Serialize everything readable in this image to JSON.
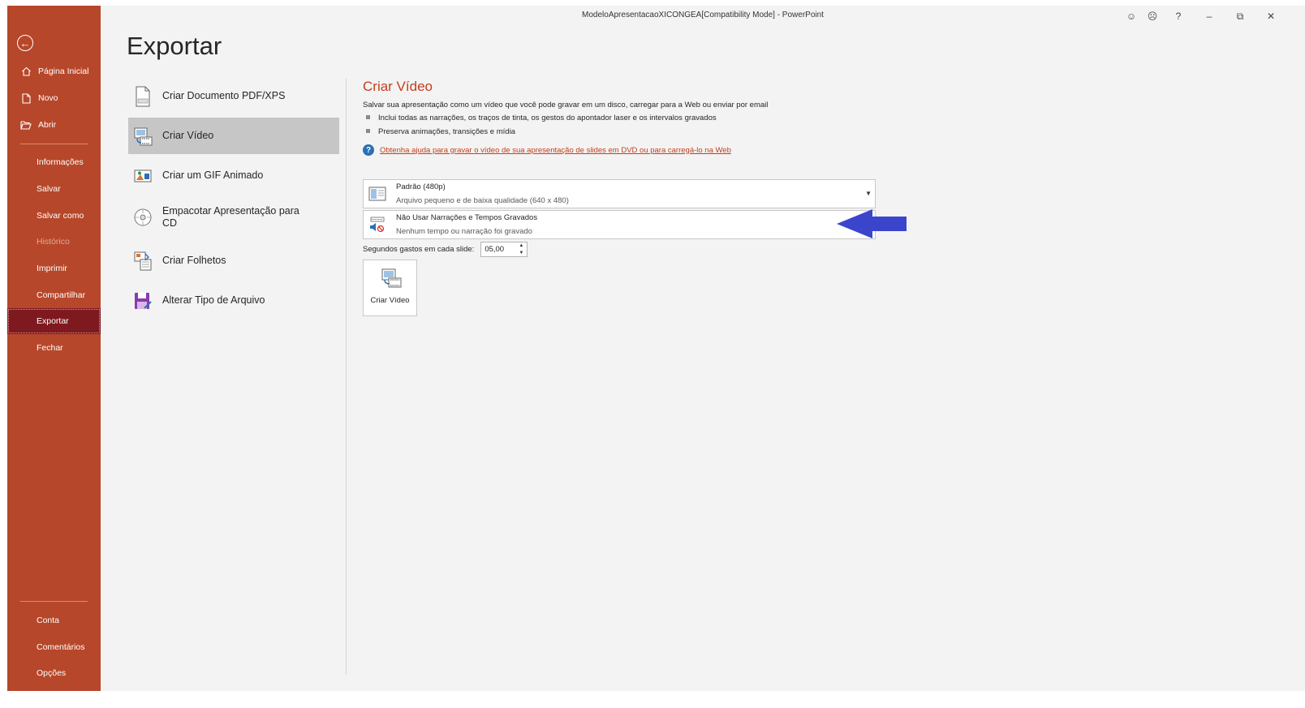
{
  "window": {
    "title": "ModeloApresentacaoXICONGEA[Compatibility Mode]  -  PowerPoint",
    "buttons": {
      "smile": "☺",
      "frown": "☹",
      "help": "?",
      "minimize": "–",
      "restore": "⧉",
      "close": "✕"
    }
  },
  "sidebar": {
    "back_glyph": "←",
    "top_items": [
      {
        "label": "Página Inicial",
        "icon": "home-icon"
      },
      {
        "label": "Novo",
        "icon": "new-document-icon"
      },
      {
        "label": "Abrir",
        "icon": "folder-open-icon"
      }
    ],
    "items": [
      {
        "label": "Informações"
      },
      {
        "label": "Salvar"
      },
      {
        "label": "Salvar como"
      },
      {
        "label": "Histórico",
        "disabled": true
      },
      {
        "label": "Imprimir"
      },
      {
        "label": "Compartilhar"
      },
      {
        "label": "Exportar",
        "active": true
      },
      {
        "label": "Fechar"
      }
    ],
    "bottom_items": [
      {
        "label": "Conta"
      },
      {
        "label": "Comentários"
      },
      {
        "label": "Opções"
      }
    ]
  },
  "page": {
    "title": "Exportar"
  },
  "export_options": [
    {
      "label": "Criar Documento PDF/XPS",
      "icon": "pdf-document-icon"
    },
    {
      "label": "Criar Vídeo",
      "icon": "create-video-icon",
      "selected": true
    },
    {
      "label": "Criar um GIF Animado",
      "icon": "animated-gif-icon"
    },
    {
      "label": "Empacotar Apresentação para CD",
      "icon": "cd-package-icon"
    },
    {
      "label": "Criar Folhetos",
      "icon": "handouts-icon"
    },
    {
      "label": "Alterar Tipo de Arquivo",
      "icon": "change-file-type-icon"
    }
  ],
  "video_pane": {
    "title": "Criar Vídeo",
    "description": "Salvar sua apresentação como um vídeo que você pode gravar em um disco, carregar para a Web ou enviar por email",
    "bullets": [
      "Inclui todas as narrações, os traços de tinta, os gestos do apontador laser e os intervalos gravados",
      "Preserva animações, transições e mídia"
    ],
    "help_link": "Obtenha ajuda para gravar o vídeo de sua apresentação de slides em DVD ou para carregá-lo na Web",
    "quality_dropdown": {
      "main": "Padrão (480p)",
      "sub": "Arquivo pequeno e de baixa qualidade (640 x 480)"
    },
    "narration_dropdown": {
      "main": "Não Usar Narrações e Tempos Gravados",
      "sub": "Nenhum tempo ou narração foi gravado"
    },
    "seconds_label": "Segundos gastos em cada slide:",
    "seconds_value": "05,00",
    "create_button_label": "Criar Vídeo"
  },
  "colors": {
    "sidebar_bg": "#b7472a",
    "sidebar_active": "#7e1a1f",
    "accent_title": "#c43e1c",
    "annotation_arrow": "#3b45cc"
  }
}
